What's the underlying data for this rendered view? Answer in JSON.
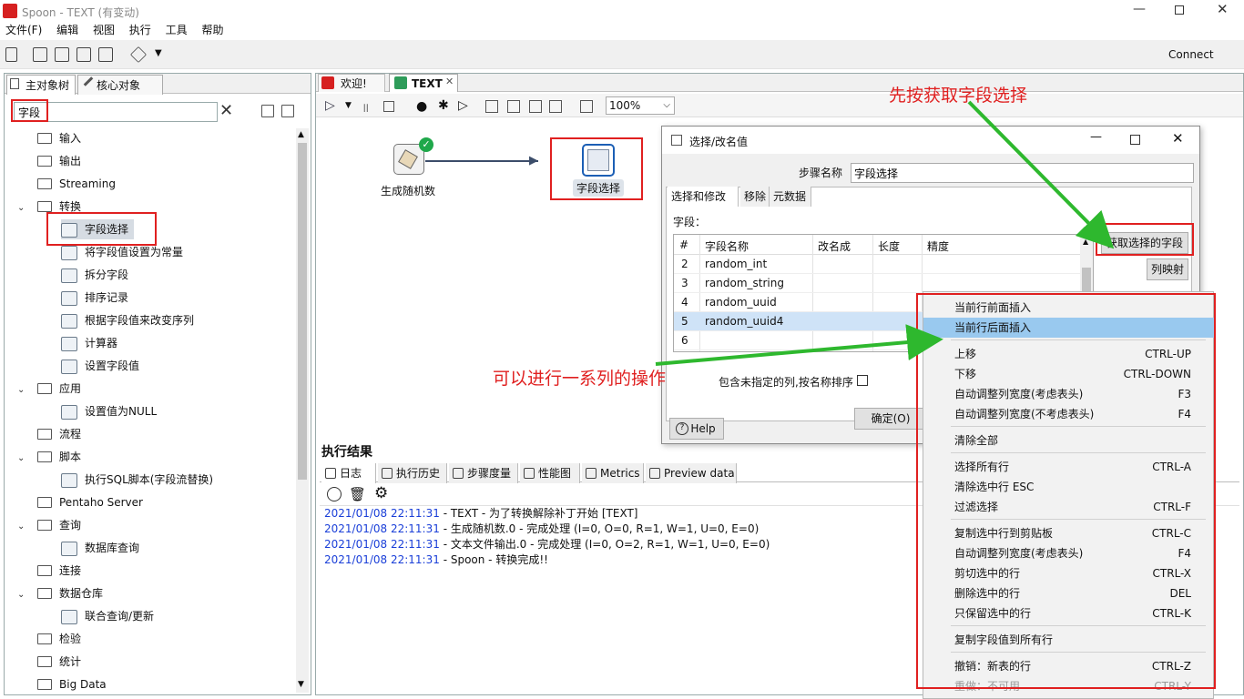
{
  "window": {
    "title": "Spoon - TEXT (有变动)"
  },
  "menu": [
    "文件(F)",
    "编辑",
    "视图",
    "执行",
    "工具",
    "帮助"
  ],
  "toolbar": {
    "connect": "Connect",
    "zoom": "100%"
  },
  "left": {
    "tabs": [
      "主对象树",
      "核心对象"
    ],
    "search_value": "字段",
    "tree": [
      {
        "label": "输入",
        "type": "folder",
        "indent": 0,
        "arrow": ""
      },
      {
        "label": "输出",
        "type": "folder",
        "indent": 0,
        "arrow": ""
      },
      {
        "label": "Streaming",
        "type": "folder",
        "indent": 0,
        "arrow": ""
      },
      {
        "label": "转换",
        "type": "folder",
        "indent": 0,
        "arrow": "v"
      },
      {
        "label": "字段选择",
        "type": "step",
        "indent": 1,
        "arrow": "",
        "selected": true
      },
      {
        "label": "将字段值设置为常量",
        "type": "step",
        "indent": 1,
        "arrow": ""
      },
      {
        "label": "拆分字段",
        "type": "step",
        "indent": 1,
        "arrow": ""
      },
      {
        "label": "排序记录",
        "type": "step",
        "indent": 1,
        "arrow": ""
      },
      {
        "label": "根据字段值来改变序列",
        "type": "step",
        "indent": 1,
        "arrow": ""
      },
      {
        "label": "计算器",
        "type": "step",
        "indent": 1,
        "arrow": ""
      },
      {
        "label": "设置字段值",
        "type": "step",
        "indent": 1,
        "arrow": ""
      },
      {
        "label": "应用",
        "type": "folder",
        "indent": 0,
        "arrow": "v"
      },
      {
        "label": "设置值为NULL",
        "type": "step",
        "indent": 1,
        "arrow": ""
      },
      {
        "label": "流程",
        "type": "folder",
        "indent": 0,
        "arrow": ""
      },
      {
        "label": "脚本",
        "type": "folder",
        "indent": 0,
        "arrow": "v"
      },
      {
        "label": "执行SQL脚本(字段流替换)",
        "type": "step",
        "indent": 1,
        "arrow": ""
      },
      {
        "label": "Pentaho Server",
        "type": "folder",
        "indent": 0,
        "arrow": ""
      },
      {
        "label": "查询",
        "type": "folder",
        "indent": 0,
        "arrow": "v"
      },
      {
        "label": "数据库查询",
        "type": "step",
        "indent": 1,
        "arrow": ""
      },
      {
        "label": "连接",
        "type": "folder",
        "indent": 0,
        "arrow": ""
      },
      {
        "label": "数据仓库",
        "type": "folder",
        "indent": 0,
        "arrow": "v"
      },
      {
        "label": "联合查询/更新",
        "type": "step",
        "indent": 1,
        "arrow": ""
      },
      {
        "label": "检验",
        "type": "folder",
        "indent": 0,
        "arrow": ""
      },
      {
        "label": "统计",
        "type": "folder",
        "indent": 0,
        "arrow": ""
      },
      {
        "label": "Big Data",
        "type": "folder",
        "indent": 0,
        "arrow": ""
      }
    ]
  },
  "editor": {
    "tabs": [
      "欢迎!",
      "TEXT"
    ],
    "nodes": {
      "node1": "生成随机数",
      "node2": "字段选择"
    },
    "results_title": "执行结果",
    "result_tabs": [
      "日志",
      "执行历史",
      "步骤度量",
      "性能图",
      "Metrics",
      "Preview data"
    ],
    "log": [
      {
        "ts": "2021/01/08 22:11:31",
        "msg": " - TEXT - 为了转换解除补丁开始  [TEXT]"
      },
      {
        "ts": "2021/01/08 22:11:31",
        "msg": " - 生成随机数.0 - 完成处理 (I=0, O=0, R=1, W=1, U=0, E=0)"
      },
      {
        "ts": "2021/01/08 22:11:31",
        "msg": " - 文本文件输出.0 - 完成处理 (I=0, O=2, R=1, W=1, U=0, E=0)"
      },
      {
        "ts": "2021/01/08 22:11:31",
        "msg": " - Spoon - 转换完成!!"
      }
    ]
  },
  "dialog": {
    "title": "选择/改名值",
    "step_name_label": "步骤名称",
    "step_name_value": "字段选择",
    "tabs": [
      "选择和修改",
      "移除",
      "元数据"
    ],
    "fields_label": "字段：",
    "columns": [
      "#",
      "字段名称",
      "改名成",
      "长度",
      "精度"
    ],
    "rows": [
      {
        "n": "2",
        "name": "random_int"
      },
      {
        "n": "3",
        "name": "random_string"
      },
      {
        "n": "4",
        "name": "random_uuid"
      },
      {
        "n": "5",
        "name": "random_uuid4"
      },
      {
        "n": "6",
        "name": ""
      }
    ],
    "get_fields": "获取选择的字段",
    "col_map": "列映射",
    "include_unspecified": "包含未指定的列,按名称排序",
    "help": "Help",
    "ok": "确定(O)"
  },
  "context_menu": [
    {
      "label": "当前行前面插入",
      "key": "",
      "sep": false
    },
    {
      "label": "当前行后面插入",
      "key": "",
      "sep": false,
      "hl": true
    },
    {
      "label": "上移",
      "key": "CTRL-UP",
      "sep": true
    },
    {
      "label": "下移",
      "key": "CTRL-DOWN",
      "sep": false
    },
    {
      "label": "自动调整列宽度(考虑表头)",
      "key": "F3",
      "sep": false
    },
    {
      "label": "自动调整列宽度(不考虑表头)",
      "key": "F4",
      "sep": false
    },
    {
      "label": " 清除全部",
      "key": "",
      "sep": true
    },
    {
      "label": "选择所有行",
      "key": "CTRL-A",
      "sep": true
    },
    {
      "label": "清除选中行 ESC",
      "key": "",
      "sep": false
    },
    {
      "label": "过滤选择",
      "key": "CTRL-F",
      "sep": false
    },
    {
      "label": "复制选中行到剪贴板",
      "key": "CTRL-C",
      "sep": true
    },
    {
      "label": "自动调整列宽度(考虑表头)",
      "key": "F4",
      "sep": false
    },
    {
      "label": "剪切选中的行",
      "key": "CTRL-X",
      "sep": false
    },
    {
      "label": "删除选中的行",
      "key": "DEL",
      "sep": false
    },
    {
      "label": "只保留选中的行",
      "key": "CTRL-K",
      "sep": false
    },
    {
      "label": "复制字段值到所有行",
      "key": "",
      "sep": true
    },
    {
      "label": "撤销：新表的行",
      "key": "CTRL-Z",
      "sep": true
    },
    {
      "label": "重做：不可用",
      "key": "CTRL-Y",
      "sep": false,
      "dim": true
    }
  ],
  "annotations": {
    "a1": "先按获取字段选择",
    "a2": "可以进行一系列的操作"
  },
  "colors": {
    "annotation": "#e02020",
    "arrow": "#2eb82e",
    "highlight": "#99c9ef",
    "timestamp": "#1a3fd8"
  }
}
